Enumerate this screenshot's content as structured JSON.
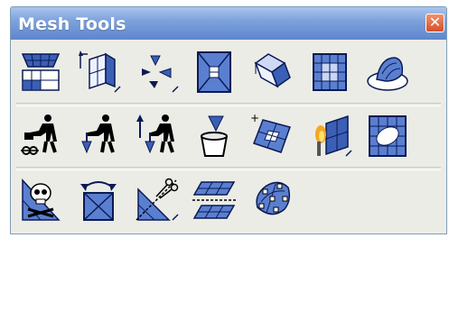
{
  "window": {
    "title": "Mesh Tools",
    "close_glyph": "✕",
    "accent_color": "#5e86cc",
    "close_color": "#d5502b"
  },
  "tools": [
    {
      "row": 1,
      "icon": "seed-mesh-icon"
    },
    {
      "row": 1,
      "icon": "seed-edge-icon"
    },
    {
      "row": 1,
      "icon": "seed-part-icon"
    },
    {
      "row": 1,
      "icon": "mesh-region-icon"
    },
    {
      "row": 1,
      "icon": "mesh-part-icon"
    },
    {
      "row": 1,
      "icon": "mesh-grid-icon"
    },
    {
      "row": 1,
      "icon": "verify-mesh-icon"
    },
    {
      "row": 2,
      "icon": "assign-element-worker-icon"
    },
    {
      "row": 2,
      "icon": "assign-mesh-control-icon"
    },
    {
      "row": 2,
      "icon": "assign-element-type-icon"
    },
    {
      "row": 2,
      "icon": "delete-mesh-bucket-icon"
    },
    {
      "row": 2,
      "icon": "create-mesh-part-icon"
    },
    {
      "row": 2,
      "icon": "edit-mesh-torch-icon"
    },
    {
      "row": 2,
      "icon": "mesh-refine-icon"
    },
    {
      "row": 3,
      "icon": "delete-native-mesh-skull-icon"
    },
    {
      "row": 3,
      "icon": "rotate-element-icon"
    },
    {
      "row": 3,
      "icon": "partition-cut-icon"
    },
    {
      "row": 3,
      "icon": "offset-mesh-icon"
    },
    {
      "row": 3,
      "icon": "orphan-mesh-nodes-icon"
    }
  ]
}
